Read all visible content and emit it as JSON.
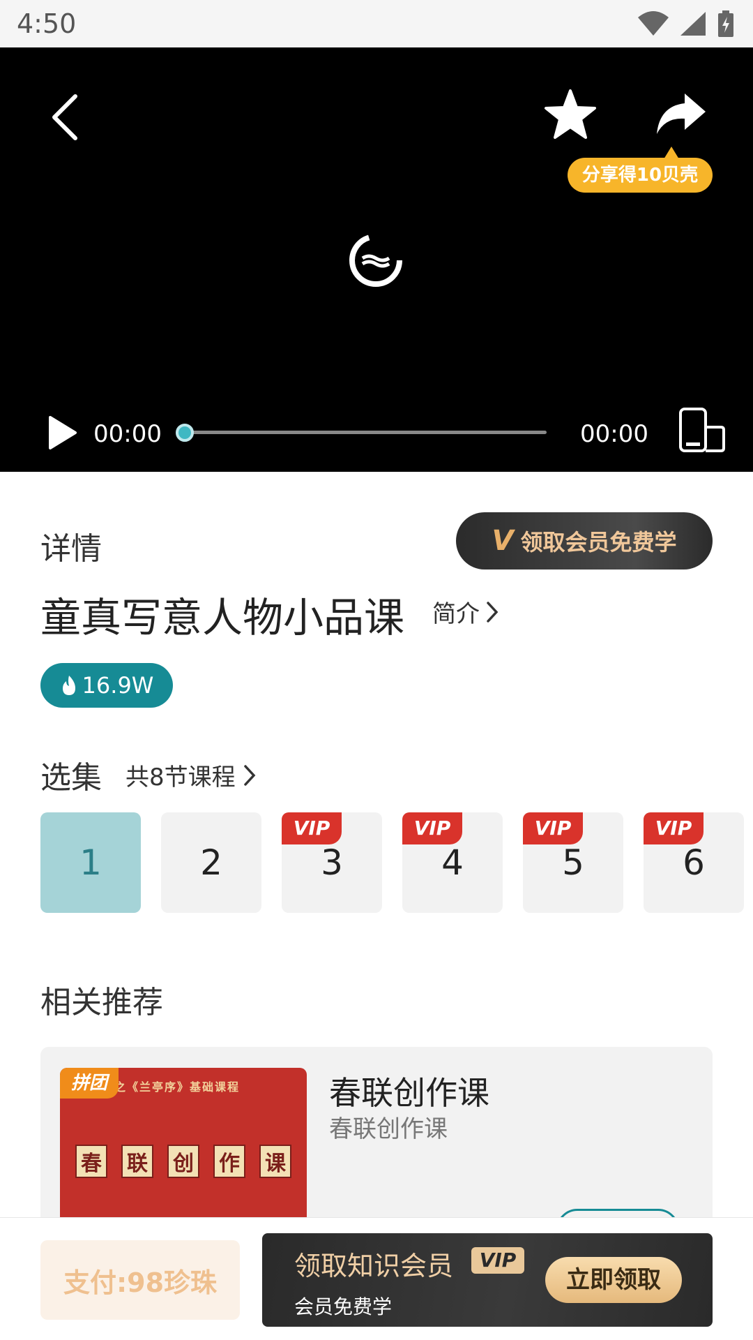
{
  "status_bar": {
    "time": "4:50"
  },
  "player": {
    "share_tip": "分享得10贝壳",
    "current_time": "00:00",
    "total_time": "00:00",
    "progress": 0
  },
  "details": {
    "section_title": "详情",
    "vip_free_label": "领取会员免费学",
    "course_title": "童真写意人物小品课",
    "intro_label": "简介",
    "hot_count": "16.9W"
  },
  "episodes": {
    "title": "选集",
    "count_label": "共8节课程",
    "vip_tag": "VIP",
    "items": [
      {
        "number": "1",
        "vip": false,
        "active": true
      },
      {
        "number": "2",
        "vip": false,
        "active": false
      },
      {
        "number": "3",
        "vip": true,
        "active": false
      },
      {
        "number": "4",
        "vip": true,
        "active": false
      },
      {
        "number": "5",
        "vip": true,
        "active": false
      },
      {
        "number": "6",
        "vip": true,
        "active": false
      }
    ]
  },
  "recommend": {
    "title": "相关推荐",
    "items": [
      {
        "tag": "拼团",
        "thumb_caption": "羲之《兰亭序》基础课程",
        "thumb_chars": [
          "春",
          "联",
          "创",
          "作",
          "课"
        ],
        "title": "春联创作课",
        "subtitle": "春联创作课"
      }
    ]
  },
  "bottom_bar": {
    "pay_label": "支付:98珍珠",
    "member_title": "领取知识会员",
    "member_vip": "VIP",
    "member_sub": "会员免费学",
    "claim_label": "立即领取"
  },
  "colors": {
    "accent": "#168b95",
    "progress_thumb": "#3fb8c3",
    "active_episode_bg": "#a5d3d7",
    "vip_red": "#d9332b",
    "share_tip": "#f7b52a",
    "gold": "#f0c79a"
  },
  "icons": {
    "back": "chevron-left-icon",
    "favorite": "star-icon",
    "share": "share-arrow-icon",
    "loading": "loading-spinner-icon",
    "play": "play-icon",
    "rotate": "rotate-screen-icon",
    "fire": "fire-icon",
    "chevron": "chevron-right-icon"
  }
}
